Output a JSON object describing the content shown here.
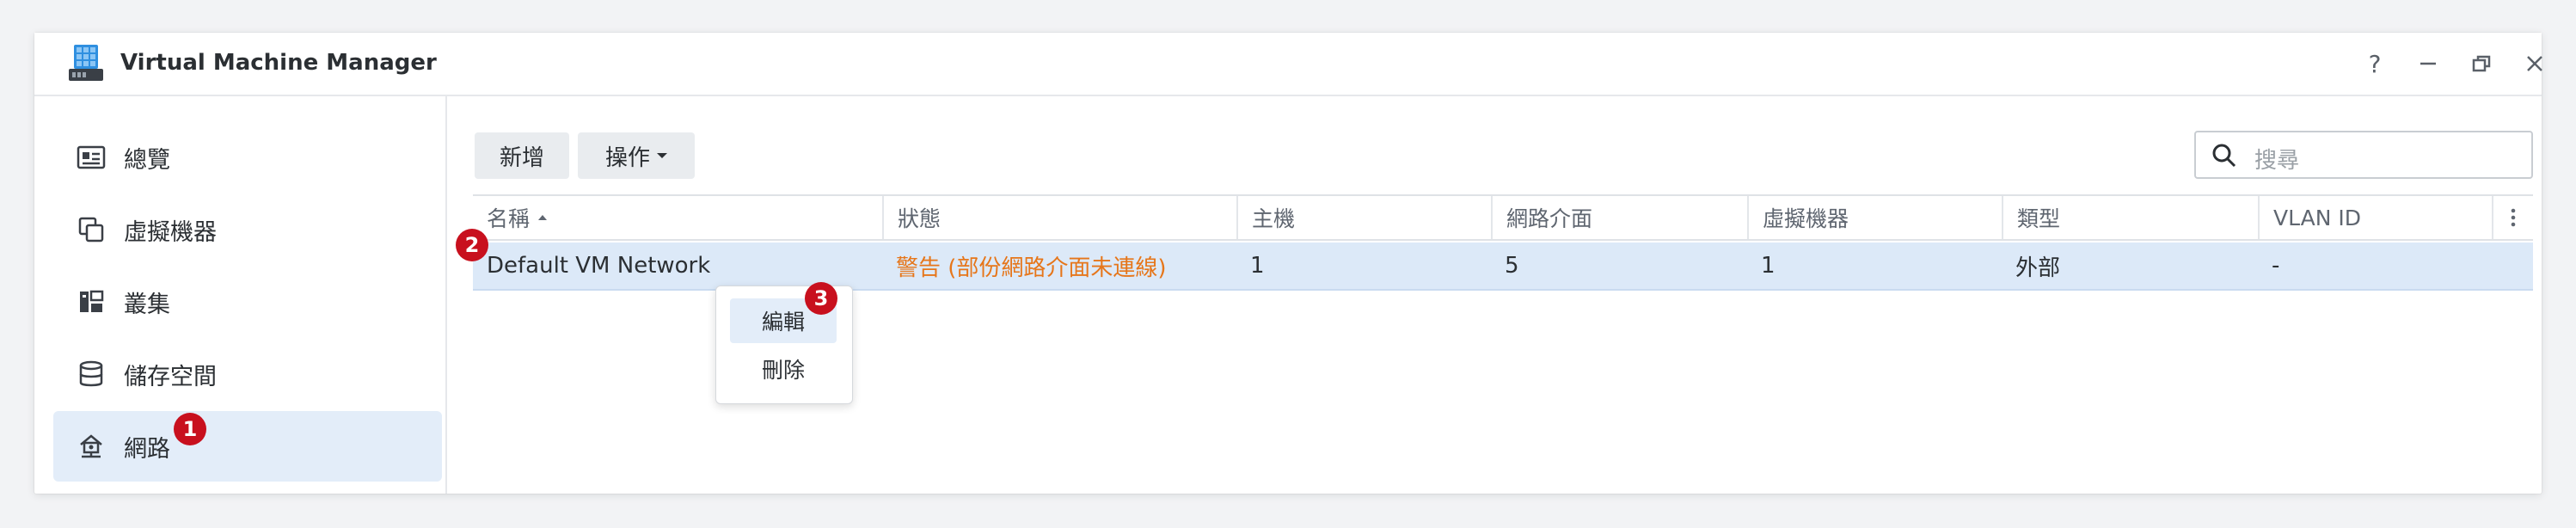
{
  "window": {
    "title": "Virtual Machine Manager",
    "controls": [
      "help-icon",
      "minimize-icon",
      "restore-icon",
      "close-icon"
    ]
  },
  "sidebar": {
    "items": [
      {
        "label": "總覽",
        "icon": "overview-icon"
      },
      {
        "label": "虛擬機器",
        "icon": "virtual-machine-icon"
      },
      {
        "label": "叢集",
        "icon": "cluster-icon"
      },
      {
        "label": "儲存空間",
        "icon": "storage-icon"
      },
      {
        "label": "網路",
        "icon": "network-icon",
        "active": true
      }
    ]
  },
  "toolbar": {
    "add_label": "新增",
    "action_label": "操作",
    "search_placeholder": "搜尋"
  },
  "table": {
    "columns": [
      "名稱",
      "狀態",
      "主機",
      "網路介面",
      "虛擬機器",
      "類型",
      "VLAN ID"
    ],
    "sort_column": "名稱",
    "rows": [
      {
        "name": "Default VM Network",
        "status": "警告 (部份網路介面未連線)",
        "host": "1",
        "interfaces": "5",
        "vms": "1",
        "type": "外部",
        "vlan": "-"
      }
    ]
  },
  "context_menu": {
    "items": [
      "編輯",
      "刪除"
    ]
  },
  "badges": [
    "1",
    "2",
    "3"
  ],
  "colors": {
    "accent": "#e3edf9",
    "selected_row": "#dce9f8",
    "warning": "#e6761a",
    "badge": "#c8101e"
  }
}
